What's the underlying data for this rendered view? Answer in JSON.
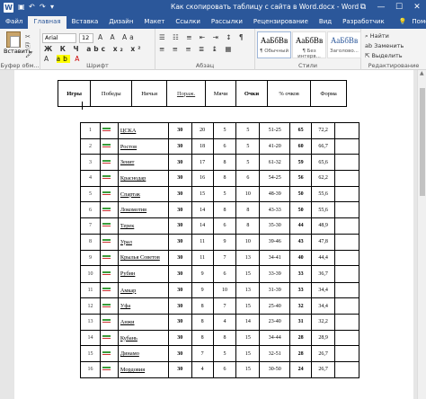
{
  "titlebar": {
    "app_icon": "W",
    "title": "Как скопировать таблицу с сайта в Word.docx - Word",
    "minimize": "—",
    "maximize": "☐",
    "close": "✕",
    "restore_icon": "⧉"
  },
  "tabs": [
    "Файл",
    "Главная",
    "Вставка",
    "Дизайн",
    "Макет",
    "Ссылки",
    "Рассылки",
    "Рецензирование",
    "Вид",
    "Разработчик"
  ],
  "tell_me": "Помощь",
  "ribbon": {
    "paste_label": "Вставить",
    "clipboard_group": "Буфер обм...",
    "font_group": "Шрифт",
    "paragraph_group": "Абзац",
    "styles_group": "Стили",
    "editing_group": "Редактирование",
    "font_name": "Arial",
    "font_size": "12",
    "styles": [
      {
        "sample": "АаБбВв",
        "name": "¶ Обычный"
      },
      {
        "sample": "АаБбВв",
        "name": "¶ Без интерв..."
      },
      {
        "sample": "АаБбВв",
        "name": "Заголово..."
      }
    ],
    "find": "Найти",
    "replace": "Заменить",
    "select": "Выделить"
  },
  "header_row": [
    "Игры",
    "Победы",
    "Ничьи",
    "Пораж.",
    "Мячи",
    "Очки",
    "% очков",
    "Форма"
  ],
  "rows": [
    {
      "n": "1",
      "team": "ЦСКА",
      "g": "30",
      "w": "20",
      "d": "5",
      "l": "5",
      "goals": "51-25",
      "pts": "65",
      "pct": "72,2"
    },
    {
      "n": "2",
      "team": "Ростов",
      "g": "30",
      "w": "18",
      "d": "6",
      "l": "5",
      "goals": "41-20",
      "pts": "60",
      "pct": "66,7"
    },
    {
      "n": "3",
      "team": "Зенит",
      "g": "30",
      "w": "17",
      "d": "8",
      "l": "5",
      "goals": "61-32",
      "pts": "59",
      "pct": "65,6"
    },
    {
      "n": "4",
      "team": "Краснодар",
      "g": "30",
      "w": "16",
      "d": "8",
      "l": "6",
      "goals": "54-25",
      "pts": "56",
      "pct": "62,2"
    },
    {
      "n": "5",
      "team": "Спартак",
      "g": "30",
      "w": "15",
      "d": "5",
      "l": "10",
      "goals": "48-39",
      "pts": "50",
      "pct": "55,6"
    },
    {
      "n": "6",
      "team": "Локомотив",
      "g": "30",
      "w": "14",
      "d": "8",
      "l": "8",
      "goals": "43-33",
      "pts": "50",
      "pct": "55,6"
    },
    {
      "n": "7",
      "team": "Терек",
      "g": "30",
      "w": "14",
      "d": "6",
      "l": "8",
      "goals": "35-30",
      "pts": "44",
      "pct": "48,9"
    },
    {
      "n": "8",
      "team": "Урал",
      "g": "30",
      "w": "11",
      "d": "9",
      "l": "10",
      "goals": "39-46",
      "pts": "43",
      "pct": "47,8"
    },
    {
      "n": "9",
      "team": "Крылья Советов",
      "g": "30",
      "w": "11",
      "d": "7",
      "l": "13",
      "goals": "34-41",
      "pts": "40",
      "pct": "44,4"
    },
    {
      "n": "10",
      "team": "Рубин",
      "g": "30",
      "w": "9",
      "d": "6",
      "l": "15",
      "goals": "33-39",
      "pts": "33",
      "pct": "36,7"
    },
    {
      "n": "11",
      "team": "Амкар",
      "g": "30",
      "w": "9",
      "d": "10",
      "l": "13",
      "goals": "31-39",
      "pts": "33",
      "pct": "34,4"
    },
    {
      "n": "12",
      "team": "Уфа",
      "g": "30",
      "w": "8",
      "d": "7",
      "l": "15",
      "goals": "25-40",
      "pts": "32",
      "pct": "34,4"
    },
    {
      "n": "13",
      "team": "Анжи",
      "g": "30",
      "w": "8",
      "d": "4",
      "l": "14",
      "goals": "23-40",
      "pts": "31",
      "pct": "32,2"
    },
    {
      "n": "14",
      "team": "Кубань",
      "g": "30",
      "w": "8",
      "d": "8",
      "l": "15",
      "goals": "34-44",
      "pts": "28",
      "pct": "28,9"
    },
    {
      "n": "15",
      "team": "Динамо",
      "g": "30",
      "w": "7",
      "d": "5",
      "l": "15",
      "goals": "32-51",
      "pts": "28",
      "pct": "26,7"
    },
    {
      "n": "16",
      "team": "Мордовия",
      "g": "30",
      "w": "4",
      "d": "6",
      "l": "15",
      "goals": "30-50",
      "pts": "24",
      "pct": "26,7"
    }
  ]
}
